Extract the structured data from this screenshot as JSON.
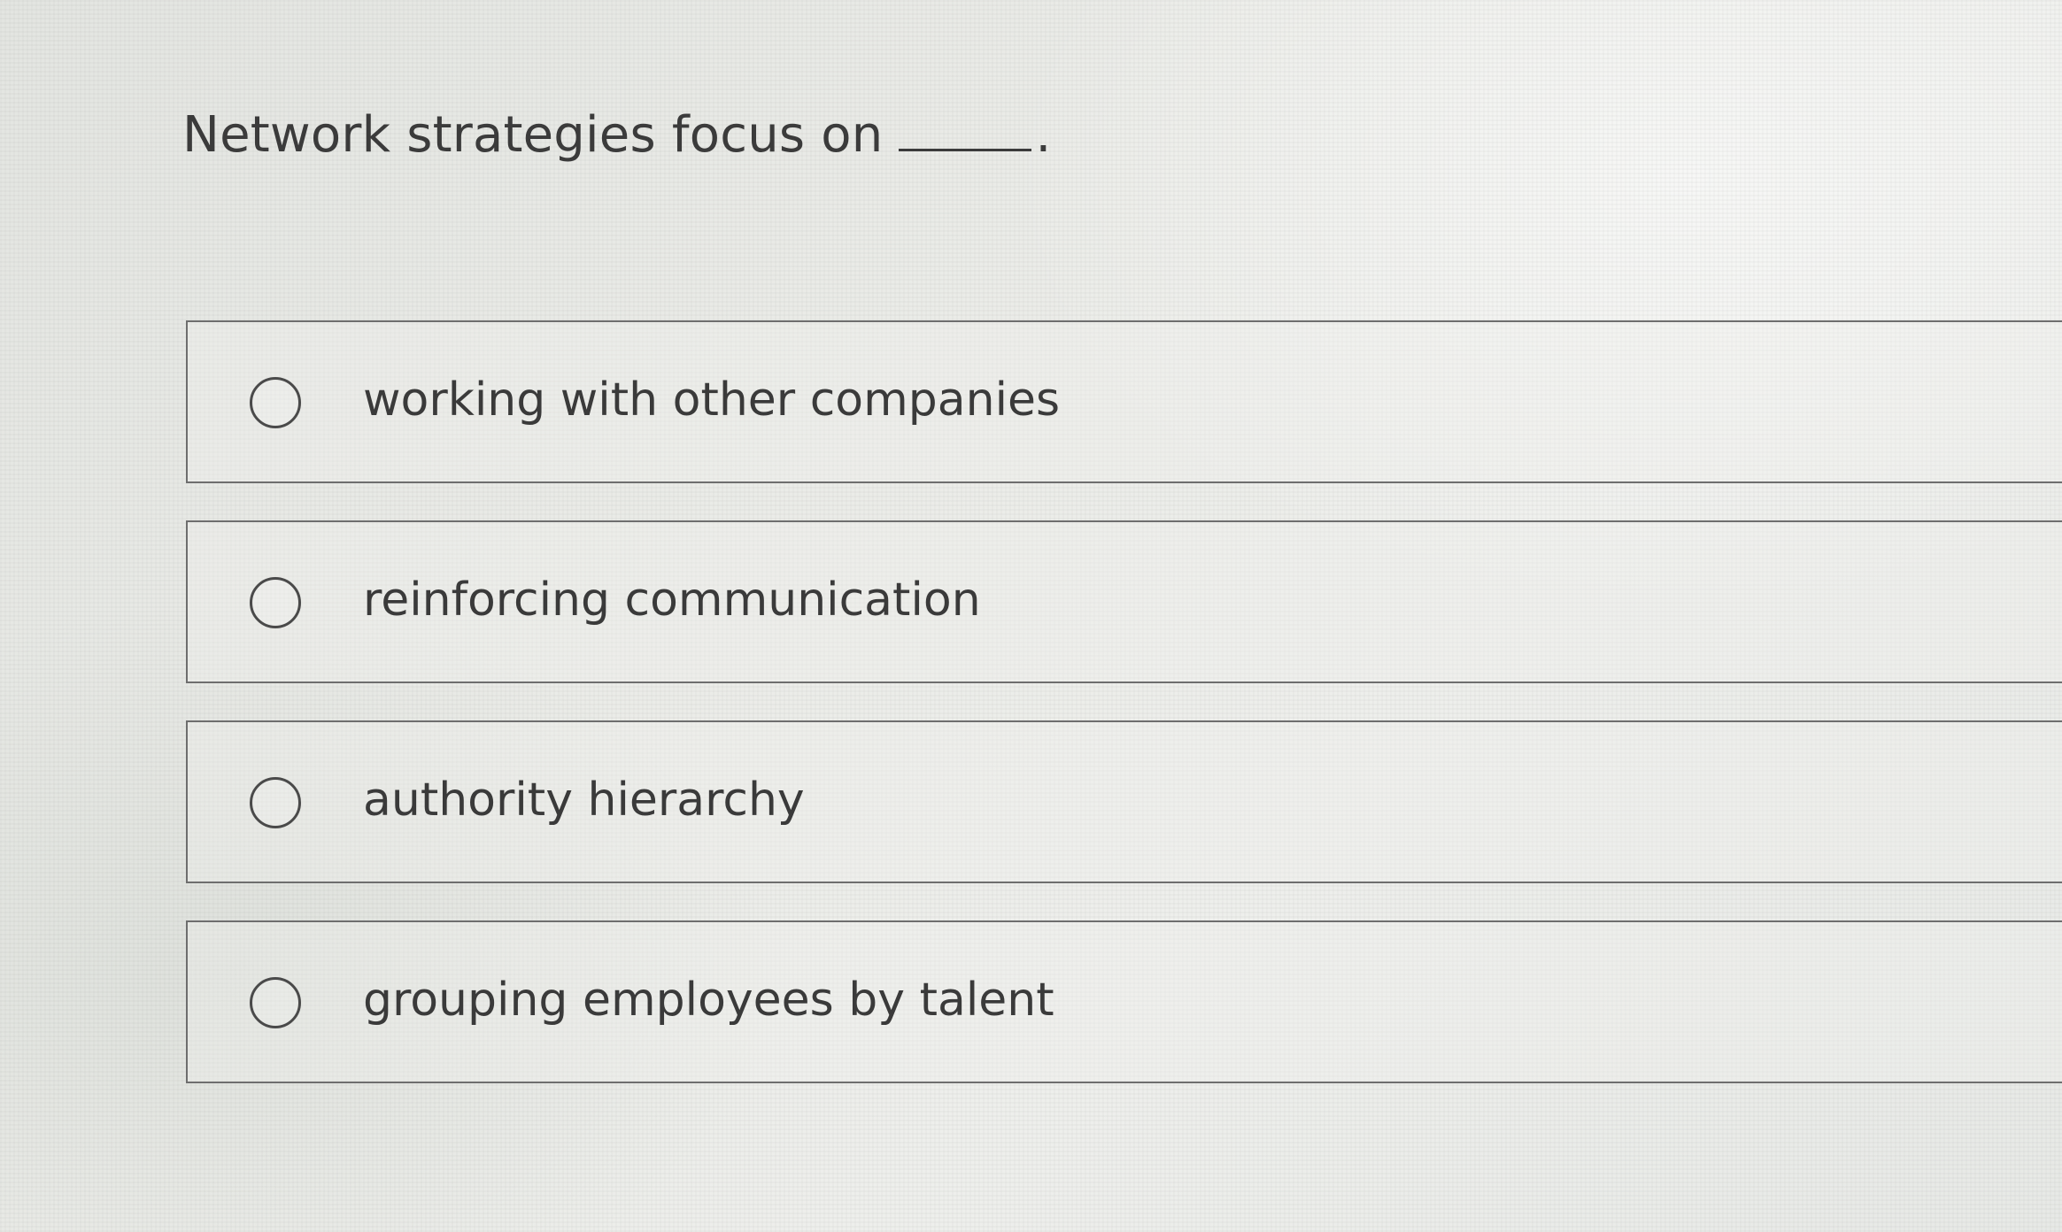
{
  "question": {
    "text": "Network strategies focus on",
    "end_punctuation": "."
  },
  "options": [
    {
      "label": "working with other companies"
    },
    {
      "label": "reinforcing communication"
    },
    {
      "label": "authority hierarchy"
    },
    {
      "label": "grouping employees by talent"
    }
  ],
  "icons": {
    "radio": "radio-unselected-icon"
  }
}
